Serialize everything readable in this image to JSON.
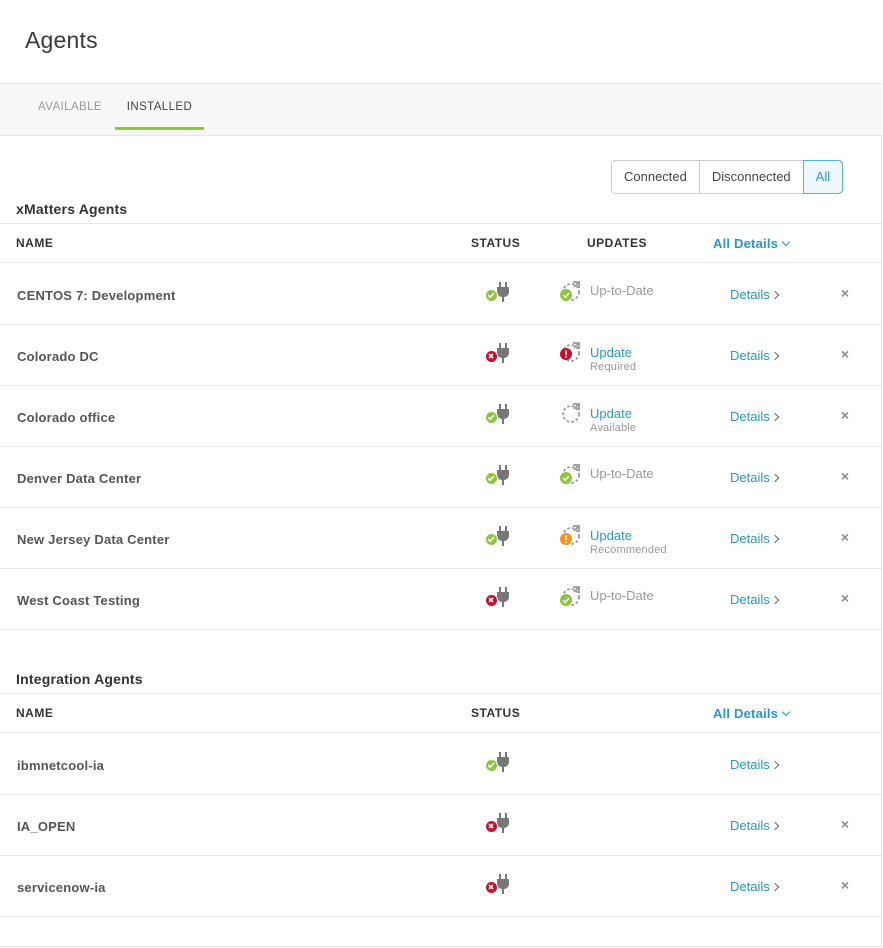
{
  "page": {
    "title": "Agents"
  },
  "tabs": {
    "available": "AVAILABLE",
    "installed": "INSTALLED"
  },
  "filters": {
    "connected": "Connected",
    "disconnected": "Disconnected",
    "all": "All",
    "selected": "All"
  },
  "colors": {
    "accent": "#2b97c6",
    "active_tab": "#8cc63f",
    "ok": "#8cc63f",
    "error": "#c8102e",
    "warning": "#f7941d"
  },
  "xmatters": {
    "title": "xMatters Agents",
    "headers": {
      "name": "NAME",
      "status": "STATUS",
      "updates": "UPDATES",
      "all_details": "All Details"
    },
    "rows": [
      {
        "name": "CENTOS 7: Development",
        "status": "connected",
        "update_icon": "update-ok-icon",
        "update_label": "Up-to-Date",
        "update_sub": "",
        "details": "Details"
      },
      {
        "name": "Colorado DC",
        "status": "disconnected",
        "update_icon": "update-required-icon",
        "update_label": "Update",
        "update_sub": "Required",
        "details": "Details"
      },
      {
        "name": "Colorado office",
        "status": "connected",
        "update_icon": "update-available-icon",
        "update_label": "Update",
        "update_sub": "Available",
        "details": "Details"
      },
      {
        "name": "Denver Data Center",
        "status": "connected",
        "update_icon": "update-ok-icon",
        "update_label": "Up-to-Date",
        "update_sub": "",
        "details": "Details"
      },
      {
        "name": "New Jersey Data Center",
        "status": "connected",
        "update_icon": "update-recommended-icon",
        "update_label": "Update",
        "update_sub": "Recommended",
        "details": "Details"
      },
      {
        "name": "West Coast Testing",
        "status": "disconnected",
        "update_icon": "update-ok-icon",
        "update_label": "Up-to-Date",
        "update_sub": "",
        "details": "Details"
      }
    ]
  },
  "integration": {
    "title": "Integration Agents",
    "headers": {
      "name": "NAME",
      "status": "STATUS",
      "all_details": "All Details"
    },
    "rows": [
      {
        "name": "ibmnetcool-ia",
        "status": "connected",
        "details": "Details",
        "removable": false
      },
      {
        "name": "IA_OPEN",
        "status": "disconnected",
        "details": "Details",
        "removable": true
      },
      {
        "name": "servicenow-ia",
        "status": "disconnected",
        "details": "Details",
        "removable": true
      }
    ]
  }
}
